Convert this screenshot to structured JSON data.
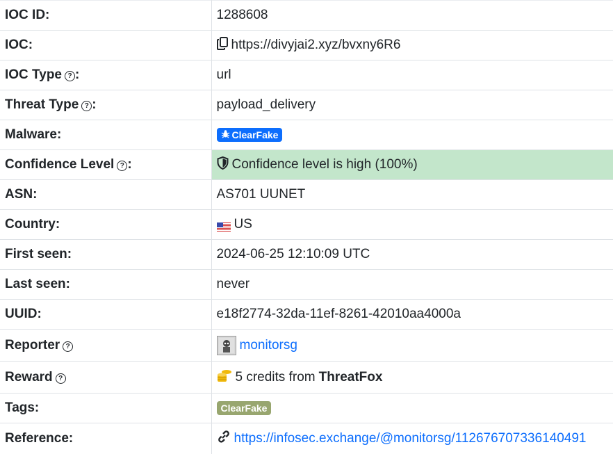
{
  "labels": {
    "ioc_id": "IOC ID:",
    "ioc": "IOC:",
    "ioc_type": "IOC Type",
    "threat_type": "Threat Type",
    "malware": "Malware:",
    "confidence": "Confidence Level",
    "asn": "ASN:",
    "country": "Country:",
    "first_seen": "First seen:",
    "last_seen": "Last seen:",
    "uuid": "UUID:",
    "reporter": "Reporter",
    "reward": "Reward",
    "tags": "Tags:",
    "reference": "Reference:",
    "colon": ":"
  },
  "values": {
    "ioc_id": "1288608",
    "ioc": "https://divyjai2.xyz/bvxny6R6",
    "ioc_type": "url",
    "threat_type": "payload_delivery",
    "malware": "ClearFake",
    "confidence": "Confidence level is high (100%)",
    "asn": "AS701 UUNET",
    "country": "US",
    "first_seen": "2024-06-25 12:10:09 UTC",
    "last_seen": "never",
    "uuid": "e18f2774-32da-11ef-8261-42010aa4000a",
    "reporter": "monitorsg",
    "reward_prefix": "5 credits from",
    "reward_source": "ThreatFox",
    "tag": "ClearFake",
    "reference": "https://infosec.exchange/@monitorsg/112676707336140491"
  },
  "icons": {
    "help": "question-circle-icon",
    "copy": "copy-icon",
    "bug": "bug-icon",
    "shield": "shield-icon",
    "flag": "us-flag-icon",
    "coins": "coins-icon",
    "link": "link-icon"
  },
  "colors": {
    "malware_badge": "#0d6efd",
    "tag_badge": "#98a66f",
    "confidence_bg": "#c3e6cb",
    "link": "#0d6efd",
    "coins": "#f0b90b"
  }
}
